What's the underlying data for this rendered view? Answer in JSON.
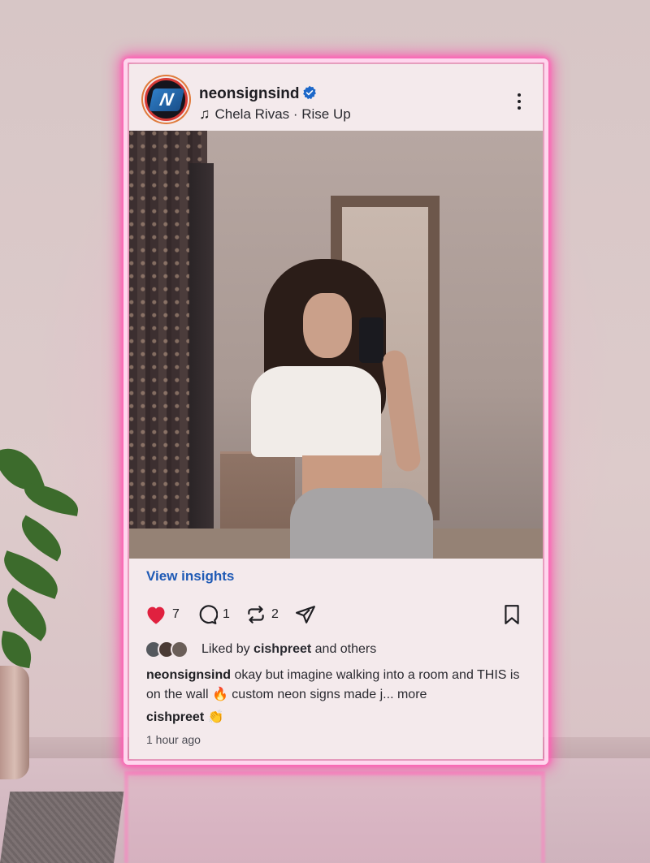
{
  "post": {
    "username": "neonsignsind",
    "avatar_text": "N",
    "music": "Chela Rivas · Rise Up",
    "view_insights": "View insights",
    "likes_count": "7",
    "comments_count": "1",
    "reposts_count": "2",
    "liked_by_prefix": "Liked by",
    "liked_by_user": "cishpreet",
    "liked_by_suffix": "and others",
    "caption_user": "neonsignsind",
    "caption_text": "okay but imagine walking into a room and THIS is on the wall 🔥 custom neon signs made j...",
    "caption_more": "more",
    "comment_user": "cishpreet",
    "comment_text": "👏",
    "timestamp": "1 hour ago"
  },
  "icons": {
    "verified": "verified-badge-icon",
    "music": "music-note-icon",
    "more": "more-options-icon",
    "like": "heart-icon",
    "comment": "comment-icon",
    "repost": "repost-icon",
    "share": "send-icon",
    "save": "bookmark-icon"
  },
  "colors": {
    "neon": "#ff5fb4",
    "card": "#f4eaec",
    "link": "#1f5ab5",
    "heart": "#e0213f",
    "verified": "#1d68c9"
  }
}
